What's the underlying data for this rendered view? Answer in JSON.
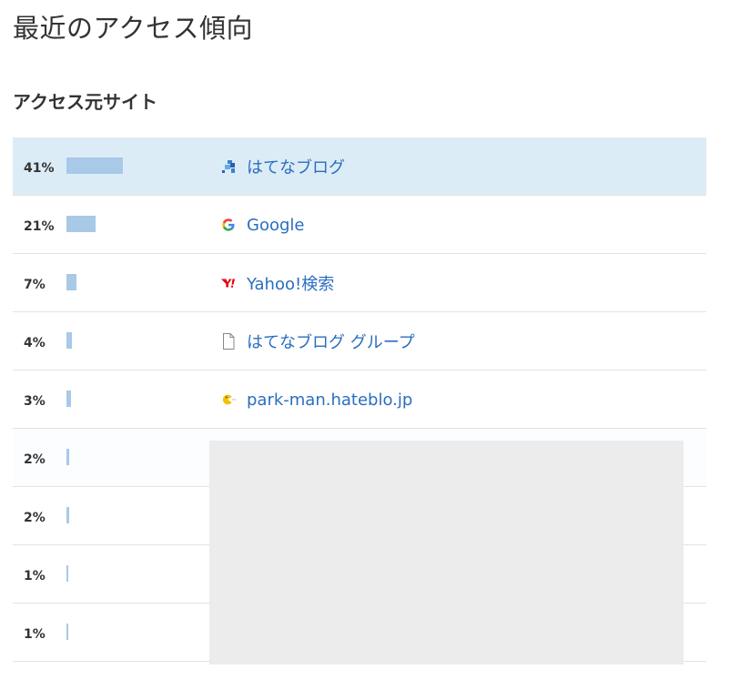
{
  "page_title": "最近のアクセス傾向",
  "section_title": "アクセス元サイト",
  "bar_color": "#a8c9e8",
  "highlight_color": "#dcecf6",
  "link_color": "#2a6ebf",
  "rows": [
    {
      "percent_label": "41%",
      "share": 0.41,
      "site": "はてなブログ",
      "icon": "hatena-blog-icon"
    },
    {
      "percent_label": "21%",
      "share": 0.21,
      "site": "Google",
      "icon": "google-icon"
    },
    {
      "percent_label": "7%",
      "share": 0.07,
      "site": "Yahoo!検索",
      "icon": "yahoo-icon"
    },
    {
      "percent_label": "4%",
      "share": 0.04,
      "site": "はてなブログ グループ",
      "icon": "document-icon"
    },
    {
      "percent_label": "3%",
      "share": 0.03,
      "site": "park-man.hateblo.jp",
      "icon": "pacman-icon"
    },
    {
      "percent_label": "2%",
      "share": 0.02,
      "site": "",
      "icon": ""
    },
    {
      "percent_label": "2%",
      "share": 0.02,
      "site": "",
      "icon": ""
    },
    {
      "percent_label": "1%",
      "share": 0.01,
      "site": "",
      "icon": ""
    },
    {
      "percent_label": "1%",
      "share": 0.01,
      "site": "",
      "icon": ""
    }
  ]
}
